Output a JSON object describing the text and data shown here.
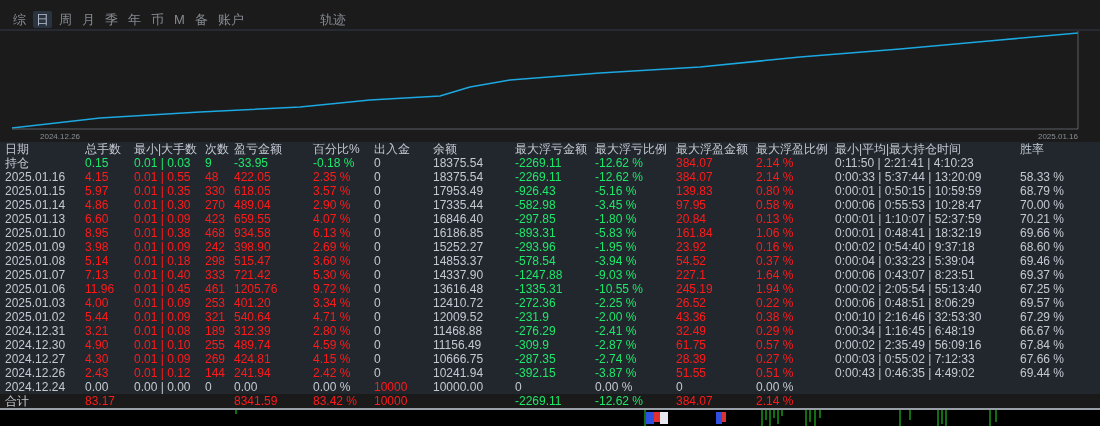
{
  "tabs": [
    {
      "label": "综",
      "selected": false
    },
    {
      "label": "日",
      "selected": true
    },
    {
      "label": "周",
      "selected": false
    },
    {
      "label": "月",
      "selected": false
    },
    {
      "label": "季",
      "selected": false
    },
    {
      "label": "年",
      "selected": false
    },
    {
      "label": "币",
      "selected": false
    },
    {
      "label": "M",
      "selected": false
    },
    {
      "label": "备",
      "selected": false
    },
    {
      "label": "账户",
      "selected": false
    }
  ],
  "track_tab": {
    "label": "轨迹",
    "selected": false
  },
  "chart": {
    "start_label": "2024.12.26",
    "end_label": "2025.01.16"
  },
  "table": {
    "columns": [
      "日期",
      "总手数",
      "最小|大手数",
      "次数",
      "盈亏金额",
      "百分比%",
      "出入金",
      "余额",
      "最大浮亏金额",
      "最大浮亏比例",
      "最大浮盈金额",
      "最大浮盈比例",
      "最小|平均|最大持仓时间",
      "胜率"
    ],
    "rows": [
      {
        "cells": [
          {
            "text": "持仓"
          },
          {
            "text": "0.15",
            "color": "#1ee86a"
          },
          {
            "text": "0.01 | 0.03",
            "color": "#1ee86a"
          },
          {
            "text": "9",
            "color": "#1ee86a"
          },
          {
            "text": "-33.95",
            "color": "#1ee86a"
          },
          {
            "text": "-0.18 %",
            "color": "#1ee86a"
          },
          {
            "text": "0",
            "color": "#c3c9d2"
          },
          {
            "text": "18375.54",
            "color": "#c3c9d2"
          },
          {
            "text": "-2269.11",
            "color": "#1ee86a"
          },
          {
            "text": "-12.62 %",
            "color": "#1ee86a"
          },
          {
            "text": "384.07",
            "color": "#ff1a1a"
          },
          {
            "text": "2.14 %",
            "color": "#ff1a1a"
          },
          {
            "text": "0:11:50 | 2:21:41 | 4:10:23",
            "color": "#c3c9d2"
          },
          null
        ]
      },
      {
        "cells": [
          {
            "text": "2025.01.16",
            "color": "#c3c9d2"
          },
          {
            "text": "4.15",
            "color": "#ff1a1a"
          },
          {
            "text": "0.01 | 0.55",
            "color": "#ff1a1a"
          },
          {
            "text": "48",
            "color": "#ff1a1a"
          },
          {
            "text": "422.05",
            "color": "#ff1a1a"
          },
          {
            "text": "2.35 %",
            "color": "#ff1a1a"
          },
          {
            "text": "0",
            "color": "#c3c9d2"
          },
          {
            "text": "18375.54",
            "color": "#c3c9d2"
          },
          {
            "text": "-2269.11",
            "color": "#1ee86a"
          },
          {
            "text": "-12.62 %",
            "color": "#1ee86a"
          },
          {
            "text": "384.07",
            "color": "#ff1a1a"
          },
          {
            "text": "2.14 %",
            "color": "#ff1a1a"
          },
          {
            "text": "0:00:33 | 5:37:44 | 13:20:09",
            "color": "#c3c9d2"
          },
          {
            "text": "58.33 %",
            "color": "#c3c9d2"
          }
        ]
      },
      {
        "cells": [
          {
            "text": "2025.01.15",
            "color": "#c3c9d2"
          },
          {
            "text": "5.97",
            "color": "#ff1a1a"
          },
          {
            "text": "0.01 | 0.35",
            "color": "#ff1a1a"
          },
          {
            "text": "330",
            "color": "#ff1a1a"
          },
          {
            "text": "618.05",
            "color": "#ff1a1a"
          },
          {
            "text": "3.57 %",
            "color": "#ff1a1a"
          },
          {
            "text": "0",
            "color": "#c3c9d2"
          },
          {
            "text": "17953.49",
            "color": "#c3c9d2"
          },
          {
            "text": "-926.43",
            "color": "#1ee86a"
          },
          {
            "text": "-5.16 %",
            "color": "#1ee86a"
          },
          {
            "text": "139.83",
            "color": "#ff1a1a"
          },
          {
            "text": "0.80 %",
            "color": "#ff1a1a"
          },
          {
            "text": "0:00:01 | 0:50:15 | 10:59:59",
            "color": "#c3c9d2"
          },
          {
            "text": "68.79 %",
            "color": "#c3c9d2"
          }
        ]
      },
      {
        "cells": [
          {
            "text": "2025.01.14",
            "color": "#c3c9d2"
          },
          {
            "text": "4.86",
            "color": "#ff1a1a"
          },
          {
            "text": "0.01 | 0.30",
            "color": "#ff1a1a"
          },
          {
            "text": "270",
            "color": "#ff1a1a"
          },
          {
            "text": "489.04",
            "color": "#ff1a1a"
          },
          {
            "text": "2.90 %",
            "color": "#ff1a1a"
          },
          {
            "text": "0",
            "color": "#c3c9d2"
          },
          {
            "text": "17335.44",
            "color": "#c3c9d2"
          },
          {
            "text": "-582.98",
            "color": "#1ee86a"
          },
          {
            "text": "-3.45 %",
            "color": "#1ee86a"
          },
          {
            "text": "97.95",
            "color": "#ff1a1a"
          },
          {
            "text": "0.58 %",
            "color": "#ff1a1a"
          },
          {
            "text": "0:00:06 | 0:55:53 | 10:28:47",
            "color": "#c3c9d2"
          },
          {
            "text": "70.00 %",
            "color": "#c3c9d2"
          }
        ]
      },
      {
        "cells": [
          {
            "text": "2025.01.13",
            "color": "#c3c9d2"
          },
          {
            "text": "6.60",
            "color": "#ff1a1a"
          },
          {
            "text": "0.01 | 0.09",
            "color": "#ff1a1a"
          },
          {
            "text": "423",
            "color": "#ff1a1a"
          },
          {
            "text": "659.55",
            "color": "#ff1a1a"
          },
          {
            "text": "4.07 %",
            "color": "#ff1a1a"
          },
          {
            "text": "0",
            "color": "#c3c9d2"
          },
          {
            "text": "16846.40",
            "color": "#c3c9d2"
          },
          {
            "text": "-297.85",
            "color": "#1ee86a"
          },
          {
            "text": "-1.80 %",
            "color": "#1ee86a"
          },
          {
            "text": "20.84",
            "color": "#ff1a1a"
          },
          {
            "text": "0.13 %",
            "color": "#ff1a1a"
          },
          {
            "text": "0:00:01 | 1:10:07 | 52:37:59",
            "color": "#c3c9d2"
          },
          {
            "text": "70.21 %",
            "color": "#c3c9d2"
          }
        ]
      },
      {
        "cells": [
          {
            "text": "2025.01.10",
            "color": "#c3c9d2"
          },
          {
            "text": "8.95",
            "color": "#ff1a1a"
          },
          {
            "text": "0.01 | 0.38",
            "color": "#ff1a1a"
          },
          {
            "text": "468",
            "color": "#ff1a1a"
          },
          {
            "text": "934.58",
            "color": "#ff1a1a"
          },
          {
            "text": "6.13 %",
            "color": "#ff1a1a"
          },
          {
            "text": "0",
            "color": "#c3c9d2"
          },
          {
            "text": "16186.85",
            "color": "#c3c9d2"
          },
          {
            "text": "-893.31",
            "color": "#1ee86a"
          },
          {
            "text": "-5.83 %",
            "color": "#1ee86a"
          },
          {
            "text": "161.84",
            "color": "#ff1a1a"
          },
          {
            "text": "1.06 %",
            "color": "#ff1a1a"
          },
          {
            "text": "0:00:01 | 0:48:41 | 18:32:19",
            "color": "#c3c9d2"
          },
          {
            "text": "69.66 %",
            "color": "#c3c9d2"
          }
        ]
      },
      {
        "cells": [
          {
            "text": "2025.01.09",
            "color": "#c3c9d2"
          },
          {
            "text": "3.98",
            "color": "#ff1a1a"
          },
          {
            "text": "0.01 | 0.09",
            "color": "#ff1a1a"
          },
          {
            "text": "242",
            "color": "#ff1a1a"
          },
          {
            "text": "398.90",
            "color": "#ff1a1a"
          },
          {
            "text": "2.69 %",
            "color": "#ff1a1a"
          },
          {
            "text": "0",
            "color": "#c3c9d2"
          },
          {
            "text": "15252.27",
            "color": "#c3c9d2"
          },
          {
            "text": "-293.96",
            "color": "#1ee86a"
          },
          {
            "text": "-1.95 %",
            "color": "#1ee86a"
          },
          {
            "text": "23.92",
            "color": "#ff1a1a"
          },
          {
            "text": "0.16 %",
            "color": "#ff1a1a"
          },
          {
            "text": "0:00:02 | 0:54:40 | 9:37:18",
            "color": "#c3c9d2"
          },
          {
            "text": "68.60 %",
            "color": "#c3c9d2"
          }
        ]
      },
      {
        "cells": [
          {
            "text": "2025.01.08",
            "color": "#c3c9d2"
          },
          {
            "text": "5.14",
            "color": "#ff1a1a"
          },
          {
            "text": "0.01 | 0.18",
            "color": "#ff1a1a"
          },
          {
            "text": "298",
            "color": "#ff1a1a"
          },
          {
            "text": "515.47",
            "color": "#ff1a1a"
          },
          {
            "text": "3.60 %",
            "color": "#ff1a1a"
          },
          {
            "text": "0",
            "color": "#c3c9d2"
          },
          {
            "text": "14853.37",
            "color": "#c3c9d2"
          },
          {
            "text": "-578.54",
            "color": "#1ee86a"
          },
          {
            "text": "-3.94 %",
            "color": "#1ee86a"
          },
          {
            "text": "54.52",
            "color": "#ff1a1a"
          },
          {
            "text": "0.37 %",
            "color": "#ff1a1a"
          },
          {
            "text": "0:00:04 | 0:33:23 | 5:39:04",
            "color": "#c3c9d2"
          },
          {
            "text": "69.46 %",
            "color": "#c3c9d2"
          }
        ]
      },
      {
        "cells": [
          {
            "text": "2025.01.07",
            "color": "#c3c9d2"
          },
          {
            "text": "7.13",
            "color": "#ff1a1a"
          },
          {
            "text": "0.01 | 0.40",
            "color": "#ff1a1a"
          },
          {
            "text": "333",
            "color": "#ff1a1a"
          },
          {
            "text": "721.42",
            "color": "#ff1a1a"
          },
          {
            "text": "5.30 %",
            "color": "#ff1a1a"
          },
          {
            "text": "0",
            "color": "#c3c9d2"
          },
          {
            "text": "14337.90",
            "color": "#c3c9d2"
          },
          {
            "text": "-1247.88",
            "color": "#1ee86a"
          },
          {
            "text": "-9.03 %",
            "color": "#1ee86a"
          },
          {
            "text": "227.1",
            "color": "#ff1a1a"
          },
          {
            "text": "1.64 %",
            "color": "#ff1a1a"
          },
          {
            "text": "0:00:06 | 0:43:07 | 8:23:51",
            "color": "#c3c9d2"
          },
          {
            "text": "69.37 %",
            "color": "#c3c9d2"
          }
        ]
      },
      {
        "cells": [
          {
            "text": "2025.01.06",
            "color": "#c3c9d2"
          },
          {
            "text": "11.96",
            "color": "#ff1a1a"
          },
          {
            "text": "0.01 | 0.45",
            "color": "#ff1a1a"
          },
          {
            "text": "461",
            "color": "#ff1a1a"
          },
          {
            "text": "1205.76",
            "color": "#ff1a1a"
          },
          {
            "text": "9.72 %",
            "color": "#ff1a1a"
          },
          {
            "text": "0",
            "color": "#c3c9d2"
          },
          {
            "text": "13616.48",
            "color": "#c3c9d2"
          },
          {
            "text": "-1335.31",
            "color": "#1ee86a"
          },
          {
            "text": "-10.55 %",
            "color": "#1ee86a"
          },
          {
            "text": "245.19",
            "color": "#ff1a1a"
          },
          {
            "text": "1.94 %",
            "color": "#ff1a1a"
          },
          {
            "text": "0:00:02 | 2:05:54 | 55:13:40",
            "color": "#c3c9d2"
          },
          {
            "text": "67.25 %",
            "color": "#c3c9d2"
          }
        ]
      },
      {
        "cells": [
          {
            "text": "2025.01.03",
            "color": "#c3c9d2"
          },
          {
            "text": "4.00",
            "color": "#ff1a1a"
          },
          {
            "text": "0.01 | 0.09",
            "color": "#ff1a1a"
          },
          {
            "text": "253",
            "color": "#ff1a1a"
          },
          {
            "text": "401.20",
            "color": "#ff1a1a"
          },
          {
            "text": "3.34 %",
            "color": "#ff1a1a"
          },
          {
            "text": "0",
            "color": "#c3c9d2"
          },
          {
            "text": "12410.72",
            "color": "#c3c9d2"
          },
          {
            "text": "-272.36",
            "color": "#1ee86a"
          },
          {
            "text": "-2.25 %",
            "color": "#1ee86a"
          },
          {
            "text": "26.52",
            "color": "#ff1a1a"
          },
          {
            "text": "0.22 %",
            "color": "#ff1a1a"
          },
          {
            "text": "0:00:06 | 0:48:51 | 8:06:29",
            "color": "#c3c9d2"
          },
          {
            "text": "69.57 %",
            "color": "#c3c9d2"
          }
        ]
      },
      {
        "cells": [
          {
            "text": "2025.01.02",
            "color": "#c3c9d2"
          },
          {
            "text": "5.44",
            "color": "#ff1a1a"
          },
          {
            "text": "0.01 | 0.09",
            "color": "#ff1a1a"
          },
          {
            "text": "321",
            "color": "#ff1a1a"
          },
          {
            "text": "540.64",
            "color": "#ff1a1a"
          },
          {
            "text": "4.71 %",
            "color": "#ff1a1a"
          },
          {
            "text": "0",
            "color": "#c3c9d2"
          },
          {
            "text": "12009.52",
            "color": "#c3c9d2"
          },
          {
            "text": "-231.9",
            "color": "#1ee86a"
          },
          {
            "text": "-2.00 %",
            "color": "#1ee86a"
          },
          {
            "text": "43.36",
            "color": "#ff1a1a"
          },
          {
            "text": "0.38 %",
            "color": "#ff1a1a"
          },
          {
            "text": "0:00:10 | 2:16:46 | 32:53:30",
            "color": "#c3c9d2"
          },
          {
            "text": "67.29 %",
            "color": "#c3c9d2"
          }
        ]
      },
      {
        "cells": [
          {
            "text": "2024.12.31",
            "color": "#c3c9d2"
          },
          {
            "text": "3.21",
            "color": "#ff1a1a"
          },
          {
            "text": "0.01 | 0.08",
            "color": "#ff1a1a"
          },
          {
            "text": "189",
            "color": "#ff1a1a"
          },
          {
            "text": "312.39",
            "color": "#ff1a1a"
          },
          {
            "text": "2.80 %",
            "color": "#ff1a1a"
          },
          {
            "text": "0",
            "color": "#c3c9d2"
          },
          {
            "text": "11468.88",
            "color": "#c3c9d2"
          },
          {
            "text": "-276.29",
            "color": "#1ee86a"
          },
          {
            "text": "-2.41 %",
            "color": "#1ee86a"
          },
          {
            "text": "32.49",
            "color": "#ff1a1a"
          },
          {
            "text": "0.29 %",
            "color": "#ff1a1a"
          },
          {
            "text": "0:00:34 | 1:16:45 | 6:48:19",
            "color": "#c3c9d2"
          },
          {
            "text": "66.67 %",
            "color": "#c3c9d2"
          }
        ]
      },
      {
        "cells": [
          {
            "text": "2024.12.30",
            "color": "#c3c9d2"
          },
          {
            "text": "4.90",
            "color": "#ff1a1a"
          },
          {
            "text": "0.01 | 0.10",
            "color": "#ff1a1a"
          },
          {
            "text": "255",
            "color": "#ff1a1a"
          },
          {
            "text": "489.74",
            "color": "#ff1a1a"
          },
          {
            "text": "4.59 %",
            "color": "#ff1a1a"
          },
          {
            "text": "0",
            "color": "#c3c9d2"
          },
          {
            "text": "11156.49",
            "color": "#c3c9d2"
          },
          {
            "text": "-309.9",
            "color": "#1ee86a"
          },
          {
            "text": "-2.87 %",
            "color": "#1ee86a"
          },
          {
            "text": "61.75",
            "color": "#ff1a1a"
          },
          {
            "text": "0.57 %",
            "color": "#ff1a1a"
          },
          {
            "text": "0:00:02 | 2:35:49 | 56:09:16",
            "color": "#c3c9d2"
          },
          {
            "text": "67.84 %",
            "color": "#c3c9d2"
          }
        ]
      },
      {
        "cells": [
          {
            "text": "2024.12.27",
            "color": "#c3c9d2"
          },
          {
            "text": "4.30",
            "color": "#ff1a1a"
          },
          {
            "text": "0.01 | 0.09",
            "color": "#ff1a1a"
          },
          {
            "text": "269",
            "color": "#ff1a1a"
          },
          {
            "text": "424.81",
            "color": "#ff1a1a"
          },
          {
            "text": "4.15 %",
            "color": "#ff1a1a"
          },
          {
            "text": "0",
            "color": "#c3c9d2"
          },
          {
            "text": "10666.75",
            "color": "#c3c9d2"
          },
          {
            "text": "-287.35",
            "color": "#1ee86a"
          },
          {
            "text": "-2.74 %",
            "color": "#1ee86a"
          },
          {
            "text": "28.39",
            "color": "#ff1a1a"
          },
          {
            "text": "0.27 %",
            "color": "#ff1a1a"
          },
          {
            "text": "0:00:03 | 0:55:02 | 7:12:33",
            "color": "#c3c9d2"
          },
          {
            "text": "67.66 %",
            "color": "#c3c9d2"
          }
        ]
      },
      {
        "cells": [
          {
            "text": "2024.12.26",
            "color": "#c3c9d2"
          },
          {
            "text": "2.43",
            "color": "#ff1a1a"
          },
          {
            "text": "0.01 | 0.12",
            "color": "#ff1a1a"
          },
          {
            "text": "144",
            "color": "#ff1a1a"
          },
          {
            "text": "241.94",
            "color": "#ff1a1a"
          },
          {
            "text": "2.42 %",
            "color": "#ff1a1a"
          },
          {
            "text": "0",
            "color": "#c3c9d2"
          },
          {
            "text": "10241.94",
            "color": "#c3c9d2"
          },
          {
            "text": "-392.15",
            "color": "#1ee86a"
          },
          {
            "text": "-3.87 %",
            "color": "#1ee86a"
          },
          {
            "text": "51.55",
            "color": "#ff1a1a"
          },
          {
            "text": "0.51 %",
            "color": "#ff1a1a"
          },
          {
            "text": "0:00:43 | 0:46:35 | 4:49:02",
            "color": "#c3c9d2"
          },
          {
            "text": "69.44 %",
            "color": "#c3c9d2"
          }
        ]
      },
      {
        "cells": [
          {
            "text": "2024.12.24",
            "color": "#c3c9d2"
          },
          {
            "text": "0.00",
            "color": "#c3c9d2"
          },
          {
            "text": "0.00 | 0.00",
            "color": "#c3c9d2"
          },
          {
            "text": "0",
            "color": "#c3c9d2"
          },
          {
            "text": "0.00",
            "color": "#c3c9d2"
          },
          {
            "text": "0.00 %",
            "color": "#c3c9d2"
          },
          {
            "text": "10000",
            "color": "#ff1a1a"
          },
          {
            "text": "10000.00",
            "color": "#c3c9d2"
          },
          {
            "text": "0",
            "color": "#c3c9d2"
          },
          {
            "text": "0.00 %",
            "color": "#c3c9d2"
          },
          {
            "text": "0",
            "color": "#c3c9d2"
          },
          {
            "text": "0.00 %",
            "color": "#c3c9d2"
          },
          null,
          null
        ]
      }
    ],
    "total": {
      "cells": [
        {
          "text": "合计"
        },
        {
          "text": "83.17",
          "color": "#ff1a1a"
        },
        null,
        null,
        {
          "text": "8341.59",
          "color": "#ff1a1a"
        },
        {
          "text": "83.42 %",
          "color": "#ff1a1a"
        },
        {
          "text": "10000",
          "color": "#ff1a1a"
        },
        null,
        {
          "text": "-2269.11",
          "color": "#1ee86a"
        },
        {
          "text": "-12.62 %",
          "color": "#1ee86a"
        },
        {
          "text": "384.07",
          "color": "#ff1a1a"
        },
        {
          "text": "2.14 %",
          "color": "#ff1a1a"
        },
        null,
        null
      ]
    }
  }
}
